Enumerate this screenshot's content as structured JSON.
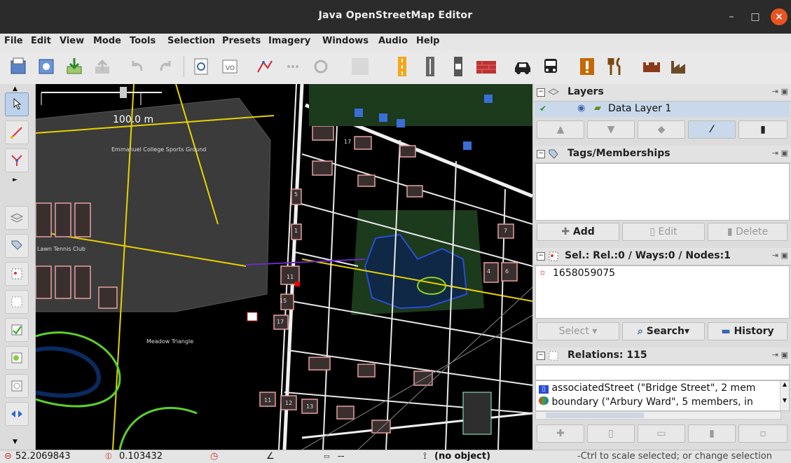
{
  "window": {
    "title": "Java OpenStreetMap Editor"
  },
  "menu": [
    "File",
    "Edit",
    "View",
    "Mode",
    "Tools",
    "Selection",
    "Presets",
    "Imagery",
    "Windows",
    "Audio",
    "Help"
  ],
  "map": {
    "scale_label": "100.0 m",
    "labels": {
      "sports_ground": "Emmanuel College Sports Ground",
      "tennis_club": "Lawn Tennis Club",
      "meadow": "Meadow Triangle"
    },
    "house_numbers": [
      "17",
      "11",
      "15",
      "17",
      "7",
      "4",
      "6",
      "5",
      "1",
      "11",
      "12",
      "13"
    ]
  },
  "panels": {
    "layers": {
      "title": "Layers",
      "items": [
        {
          "name": "Data Layer 1"
        }
      ]
    },
    "tags": {
      "title": "Tags/Memberships",
      "buttons": {
        "add": "Add",
        "edit": "Edit",
        "delete": "Delete"
      }
    },
    "selection": {
      "title": "Sel.: Rel.:0 / Ways:0 / Nodes:1",
      "items": [
        "1658059075"
      ],
      "buttons": {
        "select": "Select",
        "search": "Search",
        "history": "History"
      }
    },
    "relations": {
      "title": "Relations: 115",
      "items": [
        "associatedStreet (\"Bridge Street\", 2 mem",
        "boundary (\"Arbury Ward\", 5 members, in"
      ]
    }
  },
  "status": {
    "lat": "52.2069843",
    "lon": "0.103432",
    "dist": "--",
    "object": "(no object)",
    "help": "-Ctrl to scale selected; or change selection"
  },
  "colors": {
    "accent": "#e95420",
    "map_bg": "#000000",
    "buildings": "#e6a0a0",
    "ways": "#f2f2f2",
    "selected": "#ff0000",
    "water": "#1f3b66"
  }
}
